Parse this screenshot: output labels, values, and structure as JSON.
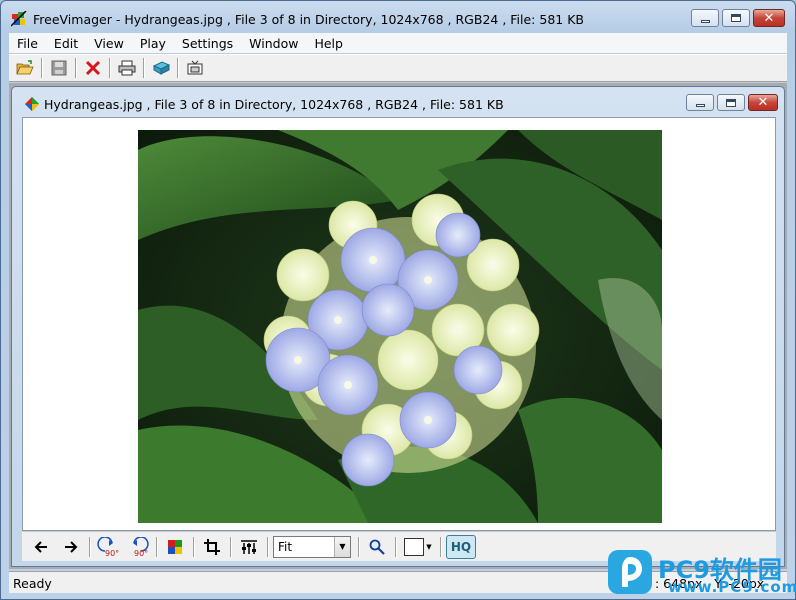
{
  "window": {
    "title": "FreeVimager - Hydrangeas.jpg , File 3 of 8 in Directory, 1024x768 , RGB24 , File: 581 KB",
    "minimize_label": "Minimize",
    "maximize_label": "Maximize",
    "close_label": "Close"
  },
  "menu": [
    "File",
    "Edit",
    "View",
    "Play",
    "Settings",
    "Window",
    "Help"
  ],
  "toolbar": {
    "icons": [
      "open-folder-icon",
      "save-icon",
      "delete-icon",
      "print-icon",
      "scan-icon",
      "capture-icon"
    ]
  },
  "child": {
    "title": "Hydrangeas.jpg , File 3 of 8 in Directory, 1024x768 , RGB24 , File: 581 KB",
    "zoom": "Fit",
    "hq_label": "HQ",
    "rotate_left_label": "90°",
    "rotate_right_label": "90°"
  },
  "status": {
    "text": "Ready",
    "coords": ": 648px , Y: -20px"
  },
  "watermark": {
    "title": "PC9软件园",
    "url": "www.PC9.com"
  },
  "colors": {
    "accent": "#1e9be0",
    "close_red": "#c6453a"
  }
}
